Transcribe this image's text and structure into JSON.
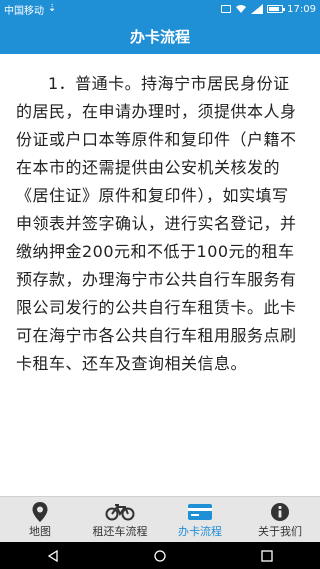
{
  "status_bar": {
    "carrier": "中国移动",
    "time": "17:09"
  },
  "header": {
    "title": "办卡流程"
  },
  "content": {
    "paragraph": "1．普通卡。持海宁市居民身份证的居民，在申请办理时，须提供本人身份证或户口本等原件和复印件（户籍不在本市的还需提供由公安机关核发的《居住证》原件和复印件），如实填写申领表并签字确认，进行实名登记，并缴纳押金200元和不低于100元的租车预存款，办理海宁市公共自行车服务有限公司发行的公共自行车租赁卡。此卡可在海宁市各公共自行车租用服务点刷卡租车、还车及查询相关信息。"
  },
  "bottom_nav": {
    "items": [
      {
        "label": "地图",
        "icon": "location-pin-icon",
        "active": false
      },
      {
        "label": "租还车流程",
        "icon": "bicycle-icon",
        "active": false
      },
      {
        "label": "办卡流程",
        "icon": "card-icon",
        "active": true
      },
      {
        "label": "关于我们",
        "icon": "info-icon",
        "active": false
      }
    ],
    "active_color": "#1f8fd6"
  },
  "colors": {
    "primary": "#1f8fd6"
  }
}
